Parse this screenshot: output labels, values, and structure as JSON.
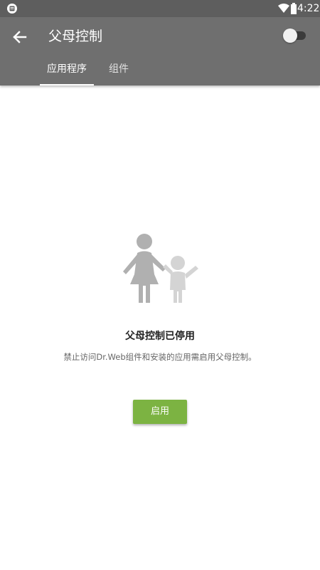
{
  "status_bar": {
    "time": "4:22",
    "icons": [
      "notification-icon",
      "wifi-icon",
      "battery-icon"
    ]
  },
  "app_bar": {
    "title": "父母控制",
    "toggle_state": "off"
  },
  "tabs": [
    {
      "label": "应用程序",
      "active": true
    },
    {
      "label": "组件",
      "active": false
    }
  ],
  "empty_state": {
    "icon": "parent-child-icon",
    "title": "父母控制已停用",
    "description": "禁止访问Dr.Web组件和安装的应用需启用父母控制。",
    "button_label": "启用"
  },
  "colors": {
    "status_bar": "#5e5e5e",
    "app_bar": "#6f6f6f",
    "accent_button": "#7cb342",
    "illustration_adult": "#b0b0b0",
    "illustration_child": "#d4d4d4"
  }
}
